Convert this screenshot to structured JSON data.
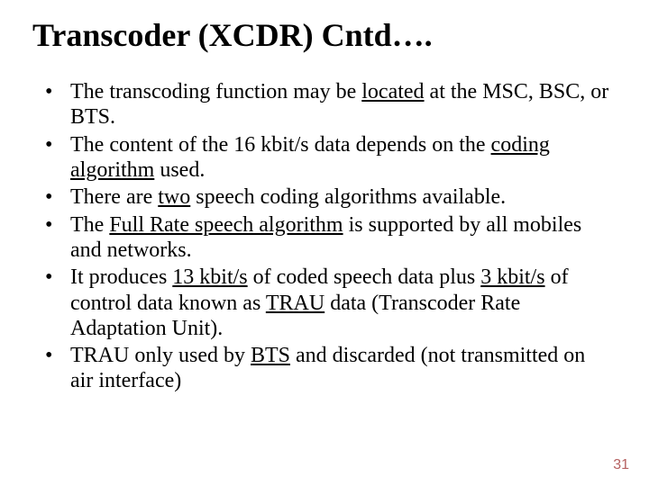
{
  "title": "Transcoder (XCDR) Cntd….",
  "bullets": [
    {
      "segments": [
        {
          "t": "The transcoding function may be "
        },
        {
          "t": "located",
          "u": true
        },
        {
          "t": " at the MSC, BSC, or BTS."
        }
      ]
    },
    {
      "segments": [
        {
          "t": "The content of the 16 kbit/s data depends on the "
        },
        {
          "t": "coding algorithm",
          "u": true
        },
        {
          "t": " used."
        }
      ]
    },
    {
      "segments": [
        {
          "t": "There are "
        },
        {
          "t": "two",
          "u": true
        },
        {
          "t": " speech coding algorithms available."
        }
      ]
    },
    {
      "segments": [
        {
          "t": "The "
        },
        {
          "t": "Full Rate speech algorithm",
          "u": true
        },
        {
          "t": " is supported by all mobiles and networks."
        }
      ]
    },
    {
      "segments": [
        {
          "t": "It produces "
        },
        {
          "t": "13 kbit/s",
          "u": true
        },
        {
          "t": " of coded speech data plus "
        },
        {
          "t": "3 kbit/s",
          "u": true
        },
        {
          "t": " of control data known as "
        },
        {
          "t": "TRAU",
          "u": true
        },
        {
          "t": " data (Transcoder Rate Adaptation Unit)."
        }
      ]
    },
    {
      "segments": [
        {
          "t": "TRAU only used by "
        },
        {
          "t": "BTS",
          "u": true
        },
        {
          "t": " and discarded (not transmitted on air interface)"
        }
      ]
    }
  ],
  "page_number": "31"
}
